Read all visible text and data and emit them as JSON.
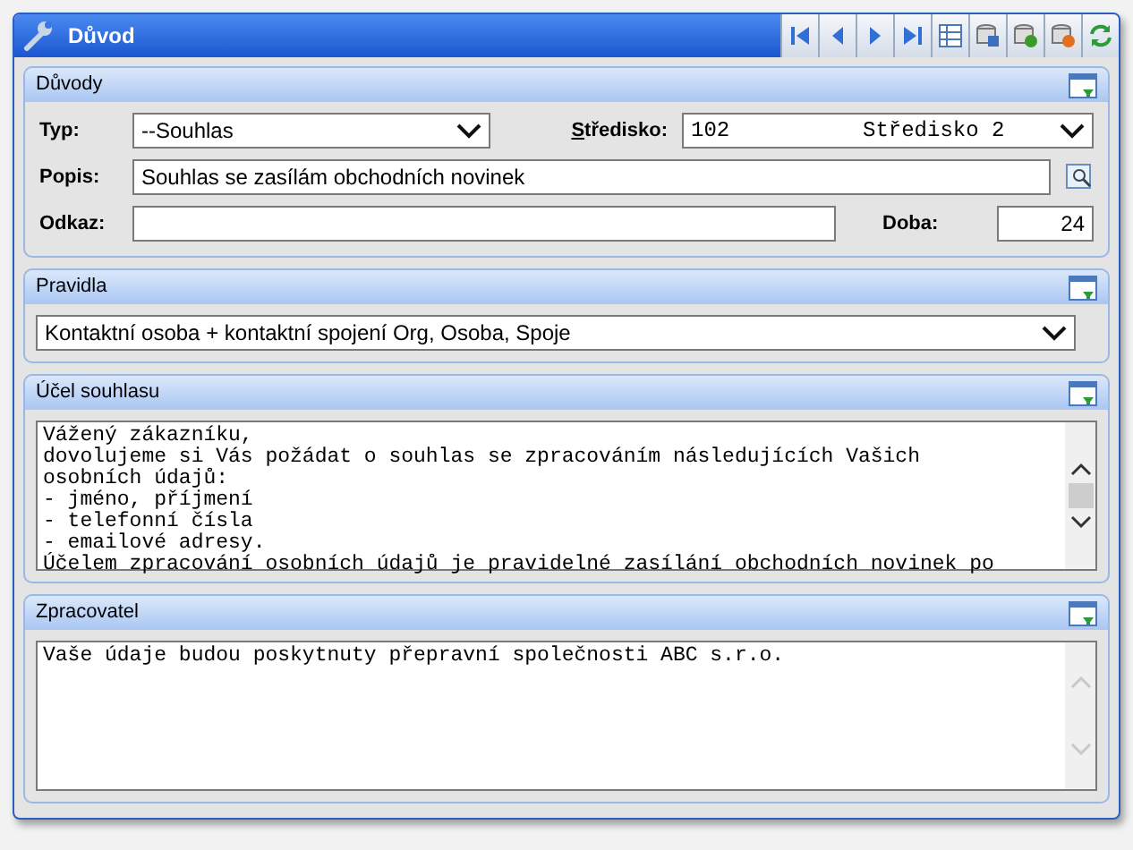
{
  "window": {
    "title": "Důvod"
  },
  "sections": [
    {
      "kind": "form",
      "title": "Důvody",
      "rows": [
        {
          "fields": [
            {
              "kind": "select",
              "label": "Typ:",
              "underline_first": false,
              "value": "--Souhlas"
            },
            {
              "kind": "select2",
              "label": "Středisko:",
              "underline_first": true,
              "value": "102",
              "value_2": "Středisko 2"
            }
          ]
        },
        {
          "fields": [
            {
              "kind": "lookup",
              "label": "Popis:",
              "underline_first": false,
              "value": "Souhlas se zasílám obchodních novinek"
            }
          ]
        },
        {
          "fields": [
            {
              "kind": "text",
              "label": "Odkaz:",
              "underline_first": false
            },
            {
              "kind": "number",
              "label": "Doba:",
              "underline_first": false,
              "value": "24"
            }
          ]
        }
      ]
    },
    {
      "kind": "select",
      "title": "Pravidla",
      "value": "Kontaktní osoba + kontaktní spojení Org, Osoba, Spoje"
    },
    {
      "kind": "memo",
      "title": "Účel souhlasu",
      "scrollable": true,
      "text": "Vážený zákazníku,\ndovolujeme si Vás požádat o souhlas se zpracováním následujících Vašich\nosobních údajů:\n- jméno, příjmení\n- telefonní čísla\n- emailové adresy.\nÚčelem zpracování osobních údajů je pravidelné zasílání obchodních novinek po"
    },
    {
      "kind": "memo",
      "title": "Zpracovatel",
      "scrollable": false,
      "text": "Vaše údaje budou poskytnuty přepravní společnosti ABC s.r.o."
    }
  ]
}
